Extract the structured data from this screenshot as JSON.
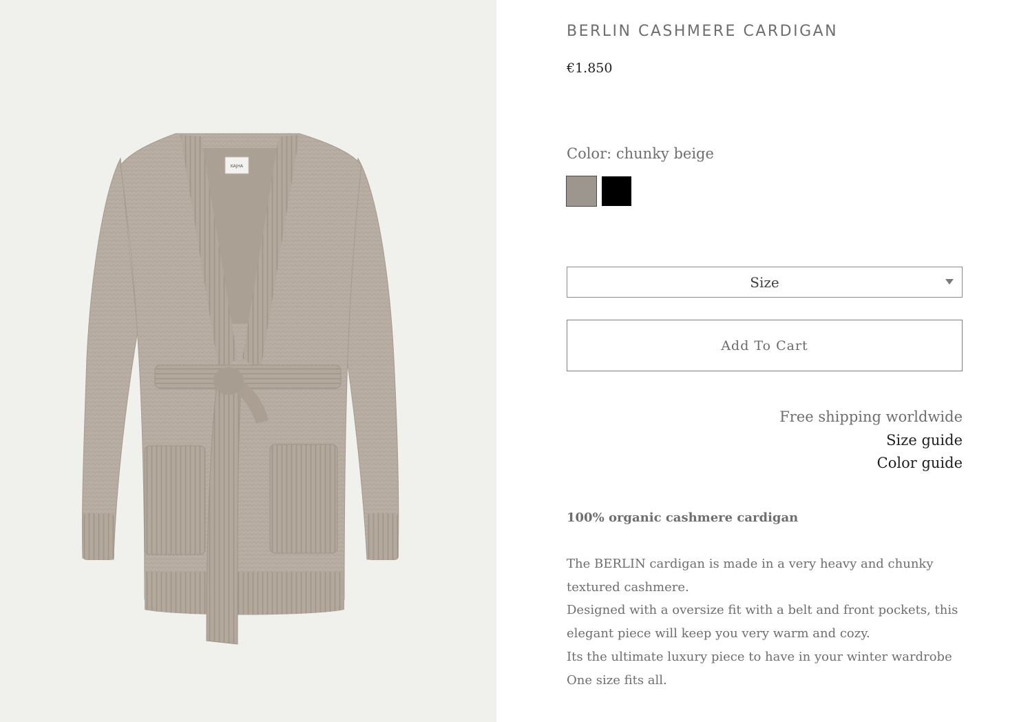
{
  "product": {
    "title": "BERLIN CASHMERE CARDIGAN",
    "price": "€1.850",
    "color_label": "Color: chunky beige",
    "swatches": [
      {
        "name": "chunky beige",
        "color": "#9c968e",
        "selected": true
      },
      {
        "name": "black",
        "color": "#000000",
        "selected": false
      }
    ],
    "image_alt_icon": "cardigan-product-image",
    "image_label": "KAJHA"
  },
  "size_select": {
    "label": "Size"
  },
  "cart": {
    "add_label": "Add To Cart"
  },
  "info": {
    "free_shipping": "Free shipping worldwide",
    "size_guide": "Size guide",
    "color_guide": "Color guide"
  },
  "description": {
    "heading": "100% organic cashmere cardigan",
    "paragraphs": [
      "The BERLIN cardigan is made in a very heavy and chunky textured cashmere.",
      "Designed with a oversize fit with a belt and front pockets, this elegant piece will keep you very warm and cozy.",
      "Its the ultimate luxury piece to have in your winter wardrobe",
      "One size fits all."
    ]
  },
  "colors": {
    "image_background": "#f0f1ed",
    "cardigan": "#b7ada2",
    "text_primary": "#1e1e1e",
    "text_secondary": "#6e6e6e"
  }
}
